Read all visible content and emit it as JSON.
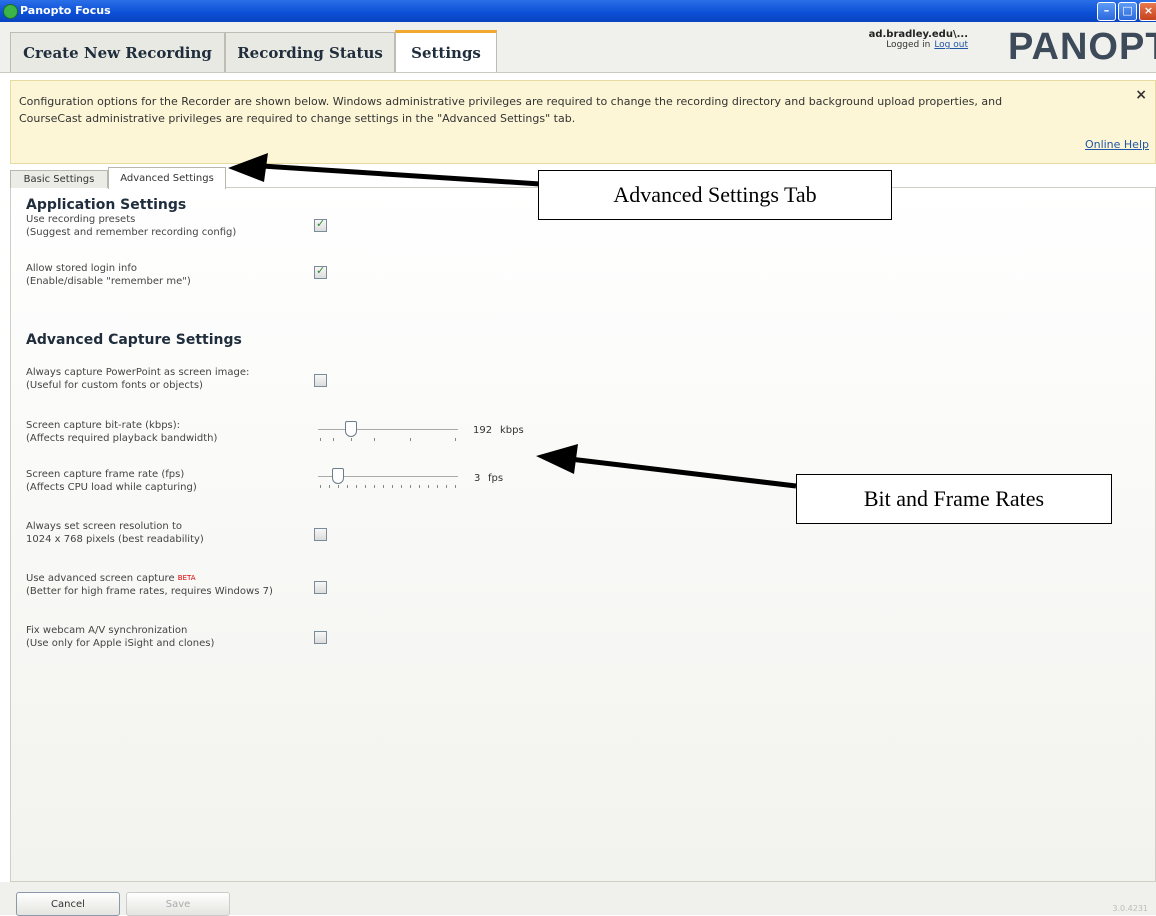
{
  "window": {
    "title": "Panopto Focus"
  },
  "tabs": [
    {
      "label": "Create New Recording"
    },
    {
      "label": "Recording Status"
    },
    {
      "label": "Settings"
    }
  ],
  "user": {
    "name": "ad.bradley.edu\\...",
    "status": "Logged in",
    "logout": "Log out"
  },
  "logo": "PANOPTO",
  "infobar": {
    "text": "Configuration options for the Recorder are shown below.  Windows administrative privileges are required to change the recording directory and background upload properties, and CourseCast administrative privileges are required to change settings in the \"Advanced Settings\" tab.",
    "close": "×",
    "help": "Online Help"
  },
  "subtabs": [
    {
      "label": "Basic Settings"
    },
    {
      "label": "Advanced Settings"
    }
  ],
  "application_settings": {
    "title": "Application Settings",
    "items": [
      {
        "label": "Use recording presets",
        "desc": "(Suggest and remember recording config)",
        "checked": true
      },
      {
        "label": "Allow stored login info",
        "desc": "(Enable/disable \"remember me\")",
        "checked": true
      }
    ]
  },
  "capture_settings": {
    "title": "Advanced Capture Settings",
    "powerpoint": {
      "label": "Always capture PowerPoint as screen image:",
      "desc": "(Useful for custom fonts or objects)",
      "checked": false
    },
    "bitrate": {
      "label": "Screen capture bit-rate (kbps):",
      "desc": "(Affects required playback bandwidth)",
      "value": "192",
      "unit": "kbps"
    },
    "framerate": {
      "label": "Screen capture frame rate (fps)",
      "desc": "(Affects CPU load while capturing)",
      "value": "3",
      "unit": "fps"
    },
    "resolution": {
      "label": "Always set screen resolution to",
      "desc": "1024 x 768 pixels (best readability)",
      "checked": false
    },
    "advanced_capture": {
      "label": "Use advanced screen capture",
      "beta": "BETA",
      "desc": "(Better for high frame rates, requires Windows 7)",
      "checked": false
    },
    "webcam": {
      "label": "Fix webcam A/V synchronization",
      "desc": "(Use only for Apple iSight and clones)",
      "checked": false
    }
  },
  "callouts": {
    "tab": "Advanced Settings Tab",
    "rates": "Bit and Frame Rates"
  },
  "buttons": {
    "cancel": "Cancel",
    "save": "Save"
  },
  "version": "3.0.4231"
}
